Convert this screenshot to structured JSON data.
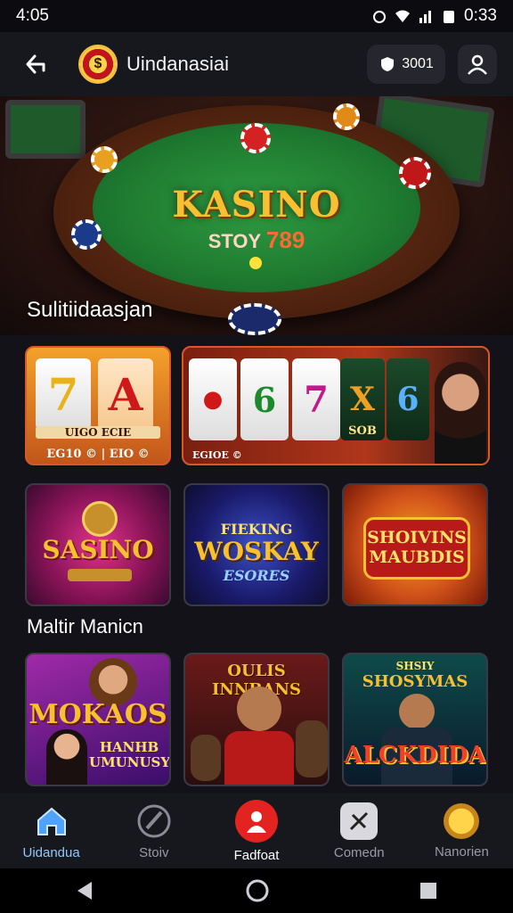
{
  "status_bar": {
    "time": "4:05",
    "right_time": "0:33"
  },
  "header": {
    "app_name": "Uindanasiai",
    "coin_value": "3001"
  },
  "hero": {
    "title": "KASINO",
    "subtitle_prefix": "STOY",
    "subtitle_number": "789",
    "section_title": "Sulitiidaasjan"
  },
  "slots": [
    {
      "label_top": "UIGO ECIE",
      "label_bottom": "EG10 © | EIO ©"
    },
    {
      "label": "SOB",
      "label_bottom": "EGIOE ©"
    }
  ],
  "games_row2": [
    {
      "title": "SASINO",
      "sub": ""
    },
    {
      "title_top": "FIEKING",
      "title": "WOSKAY",
      "sub": "ESORES"
    },
    {
      "title": "SHOIVINS MAUBDIS"
    }
  ],
  "section_title": "Maltir Manicn",
  "games_row3": [
    {
      "title": "MOKAOS",
      "sub": "HANHB UMUNUSY"
    },
    {
      "title": "OULIS INNBANS"
    },
    {
      "title_top": "SHSIY",
      "title": "SHOSYMAS",
      "sub": "ALCKDIDA"
    }
  ],
  "bottom_nav": [
    {
      "label": "Uidandua",
      "icon": "home-icon"
    },
    {
      "label": "Stoiv",
      "icon": "cards-icon"
    },
    {
      "label": "Fadfoat",
      "icon": "user-icon"
    },
    {
      "label": "Comedn",
      "icon": "tool-icon"
    },
    {
      "label": "Nanorien",
      "icon": "coin-icon"
    }
  ],
  "colors": {
    "accent": "#e3231f",
    "active_nav": "#4fa3ff",
    "gold": "#f7c030"
  }
}
